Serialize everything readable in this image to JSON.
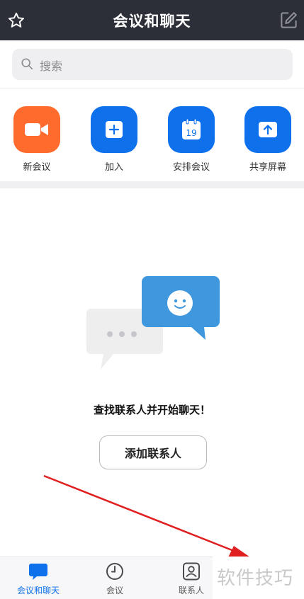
{
  "header": {
    "title": "会议和聊天"
  },
  "search": {
    "placeholder": "搜索"
  },
  "actions": [
    {
      "label": "新会议",
      "icon": "video-camera-icon",
      "color": "#ff6b2c"
    },
    {
      "label": "加入",
      "icon": "plus-icon",
      "color": "#0e71eb"
    },
    {
      "label": "安排会议",
      "icon": "calendar-icon",
      "color": "#0e71eb",
      "calendar_day": "19"
    },
    {
      "label": "共享屏幕",
      "icon": "share-screen-icon",
      "color": "#0e71eb"
    }
  ],
  "empty_state": {
    "message": "查找联系人并开始聊天！",
    "button_label": "添加联系人"
  },
  "tabs": [
    {
      "label": "会议和聊天",
      "icon": "chat-bubble-icon",
      "active": true
    },
    {
      "label": "会议",
      "icon": "clock-icon",
      "active": false
    },
    {
      "label": "联系人",
      "icon": "contacts-icon",
      "active": false
    }
  ],
  "watermark": {
    "text": "软件技巧"
  },
  "colors": {
    "header_bg": "#2d2f38",
    "accent": "#0e71eb",
    "orange": "#ff6b2c",
    "annotation_arrow": "#e02020"
  }
}
